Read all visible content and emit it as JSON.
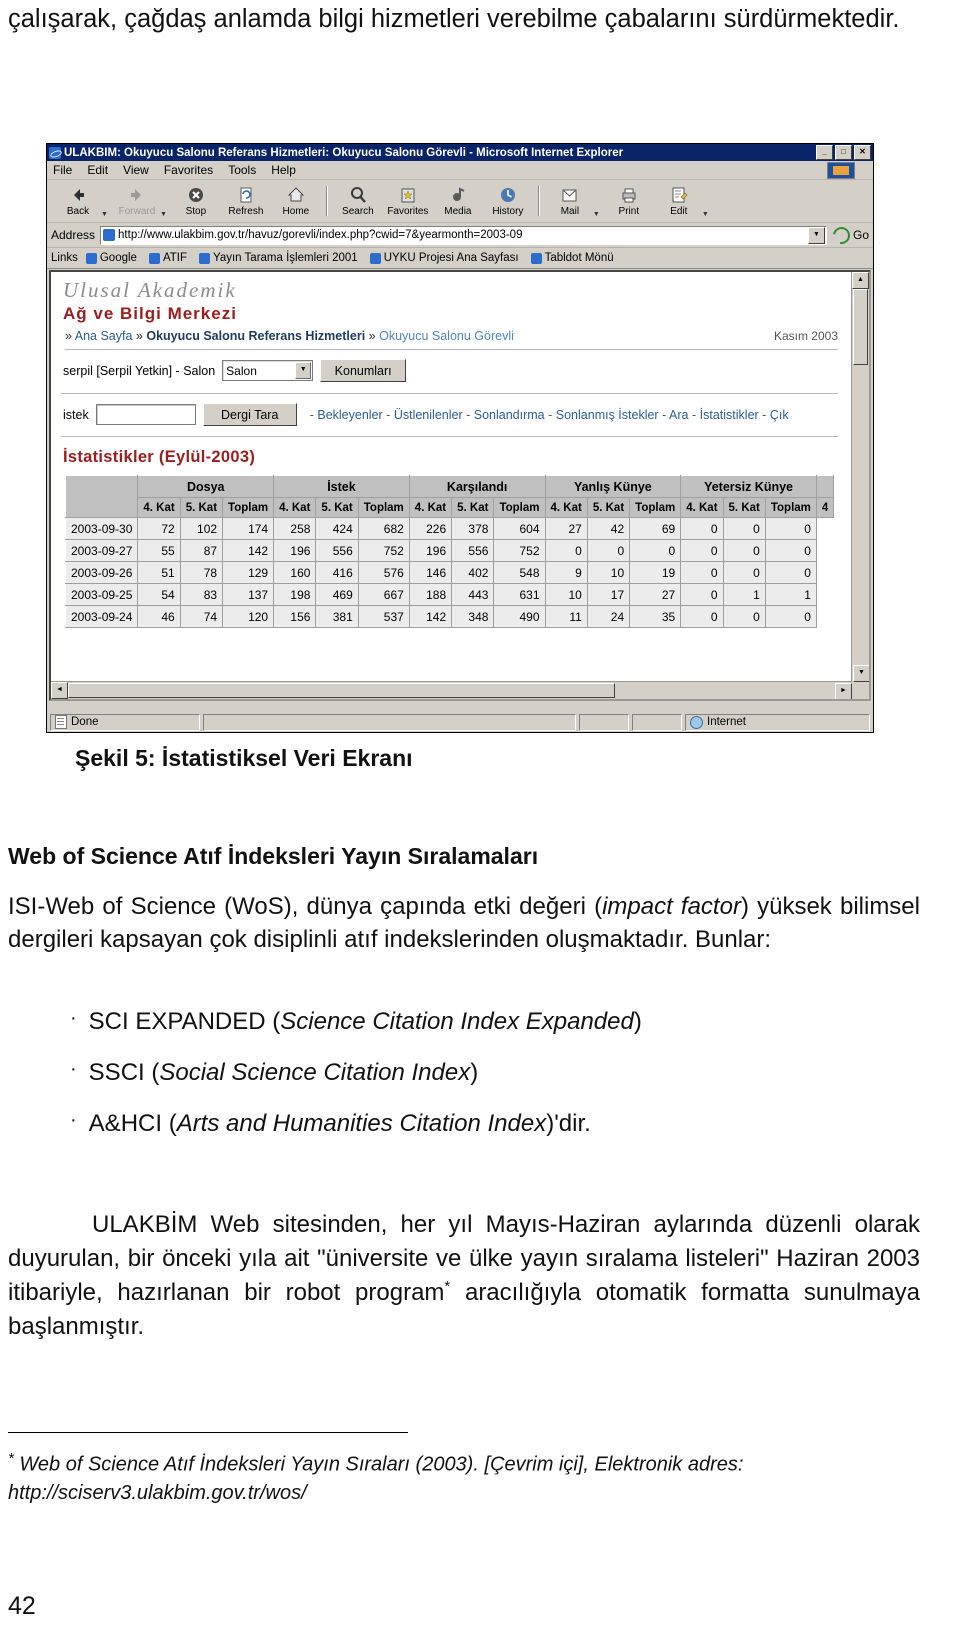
{
  "top_paragraph": "çalışarak, çağdaş anlamda bilgi hizmetleri verebilme çabalarını sürdürmektedir.",
  "browser": {
    "window_title": "ULAKBİM: Okuyucu Salonu Referans Hizmetleri: Okuyucu Salonu Görevli - Microsoft Internet Explorer",
    "window_buttons": {
      "minimize": "_",
      "maximize": "□",
      "close": "✕"
    },
    "menu": [
      "File",
      "Edit",
      "View",
      "Favorites",
      "Tools",
      "Help"
    ],
    "toolbar": [
      {
        "label": "Back",
        "icon": "back-arrow-icon",
        "disabled": false,
        "has_caret": true
      },
      {
        "label": "Forward",
        "icon": "forward-arrow-icon",
        "disabled": true,
        "has_caret": true
      },
      {
        "label": "Stop",
        "icon": "stop-icon",
        "disabled": false,
        "has_caret": false
      },
      {
        "label": "Refresh",
        "icon": "refresh-icon",
        "disabled": false,
        "has_caret": false
      },
      {
        "label": "Home",
        "icon": "home-icon",
        "disabled": false,
        "has_caret": false
      },
      {
        "label": "Search",
        "icon": "search-icon",
        "disabled": false,
        "has_caret": false
      },
      {
        "label": "Favorites",
        "icon": "favorites-star-icon",
        "disabled": false,
        "has_caret": false
      },
      {
        "label": "Media",
        "icon": "media-icon",
        "disabled": false,
        "has_caret": false
      },
      {
        "label": "History",
        "icon": "history-icon",
        "disabled": false,
        "has_caret": false
      },
      {
        "label": "Mail",
        "icon": "mail-icon",
        "disabled": false,
        "has_caret": true
      },
      {
        "label": "Print",
        "icon": "print-icon",
        "disabled": false,
        "has_caret": false
      },
      {
        "label": "Edit",
        "icon": "edit-icon",
        "disabled": false,
        "has_caret": true
      }
    ],
    "address": {
      "label": "Address",
      "url": "http://www.ulakbim.gov.tr/havuz/gorevli/index.php?cwid=7&yearmonth=2003-09",
      "go_label": "Go"
    },
    "links_bar": {
      "label": "Links",
      "items": [
        "Google",
        "ATIF",
        "Yayın Tarama İşlemleri 2001",
        "UYKU Projesi Ana Sayfası",
        "Tabldot Mönü"
      ]
    },
    "status": {
      "done": "Done",
      "zone": "Internet"
    }
  },
  "site": {
    "brand_line1": "Ulusal Akademik",
    "brand_line2": "Ağ ve Bilgi Merkezi",
    "breadcrumb": [
      "Ana Sayfa",
      "Okuyucu Salonu Referans Hizmetleri",
      "Okuyucu Salonu Görevli"
    ],
    "breadcrumb_sep": "»",
    "date_right": "Kasım 2003",
    "user_line": "serpil [Serpil Yetkin] - Salon",
    "location_select": "Salon",
    "locations_button": "Konumları",
    "search_label": "istek",
    "search_value": "",
    "search_button": "Dergi Tara",
    "nav_links": [
      "Bekleyenler",
      "Üstlenilenler",
      "Sonlandırma",
      "Sonlanmış İstekler",
      "Ara",
      "İstatistikler",
      "Çık"
    ],
    "nav_sep": "-"
  },
  "stats": {
    "title": "İstatistikler (Eylül-2003)",
    "group_headers": [
      "",
      "Dosya",
      "İstek",
      "Karşılandı",
      "Yanlış Künye",
      "Yetersiz Künye"
    ],
    "sub_headers": [
      "4. Kat",
      "5. Kat",
      "Toplam"
    ],
    "trailing_sub_header": "4",
    "rows": [
      {
        "date": "2003-09-30",
        "values": [
          72,
          102,
          174,
          258,
          424,
          682,
          226,
          378,
          604,
          27,
          42,
          69,
          0,
          0,
          0
        ]
      },
      {
        "date": "2003-09-27",
        "values": [
          55,
          87,
          142,
          196,
          556,
          752,
          196,
          556,
          752,
          0,
          0,
          0,
          0,
          0,
          0
        ]
      },
      {
        "date": "2003-09-26",
        "values": [
          51,
          78,
          129,
          160,
          416,
          576,
          146,
          402,
          548,
          9,
          10,
          19,
          0,
          0,
          0
        ]
      },
      {
        "date": "2003-09-25",
        "values": [
          54,
          83,
          137,
          198,
          469,
          667,
          188,
          443,
          631,
          10,
          17,
          27,
          0,
          1,
          1
        ]
      },
      {
        "date": "2003-09-24",
        "values": [
          46,
          74,
          120,
          156,
          381,
          537,
          142,
          348,
          490,
          11,
          24,
          35,
          0,
          0,
          0
        ]
      }
    ]
  },
  "figure_caption": "Şekil 5: İstatistiksel Veri Ekranı",
  "section_title": "Web of Science Atıf İndeksleri Yayın Sıralamaları",
  "intro_paragraph_parts": [
    {
      "text": "ISI-Web of Science (WoS), dünya çapında etki değeri (",
      "italic": false
    },
    {
      "text": "impact factor",
      "italic": true
    },
    {
      "text": ") yüksek bilimsel dergileri kapsayan çok disiplinli atıf indekslerinden oluşmaktadır. Bunlar:",
      "italic": false
    }
  ],
  "bullets": [
    {
      "marker": "·",
      "plain1": "SCI EXPANDED (",
      "italic": "Science Citation Index Expanded",
      "plain2": ")"
    },
    {
      "marker": "·",
      "plain1": "SSCI (",
      "italic": "Social Science Citation Index",
      "plain2": ")"
    },
    {
      "marker": "·",
      "plain1": "A&HCI (",
      "italic": "Arts and Humanities Citation Index",
      "plain2": ")'dir."
    }
  ],
  "closing_paragraph": "ULAKBİM Web sitesinden, her yıl Mayıs-Haziran aylarında düzenli olarak duyurulan, bir önceki yıla ait \"üniversite ve ülke yayın sıralama listeleri\" Haziran 2003 itibariyle, hazırlanan bir robot program",
  "closing_paragraph_tail": " aracılığıyla otomatik formatta sunulmaya başlanmıştır.",
  "footnote": {
    "marker": "*",
    "title": "Web of Science Atıf İndeksleri Yayın Sıraları",
    "year": "(2003).",
    "medium": "[Çevrim içi],",
    "address_label": "Elektronik adres:",
    "address": "http://sciserv3.ulakbim.gov.tr/wos/"
  },
  "page_number": "42",
  "colors": {
    "brand_red": "#9c1d1d",
    "link_blue": "#2b5f93",
    "titlebar_blue": "#0a246a",
    "chrome_gray": "#d4d0c8"
  }
}
